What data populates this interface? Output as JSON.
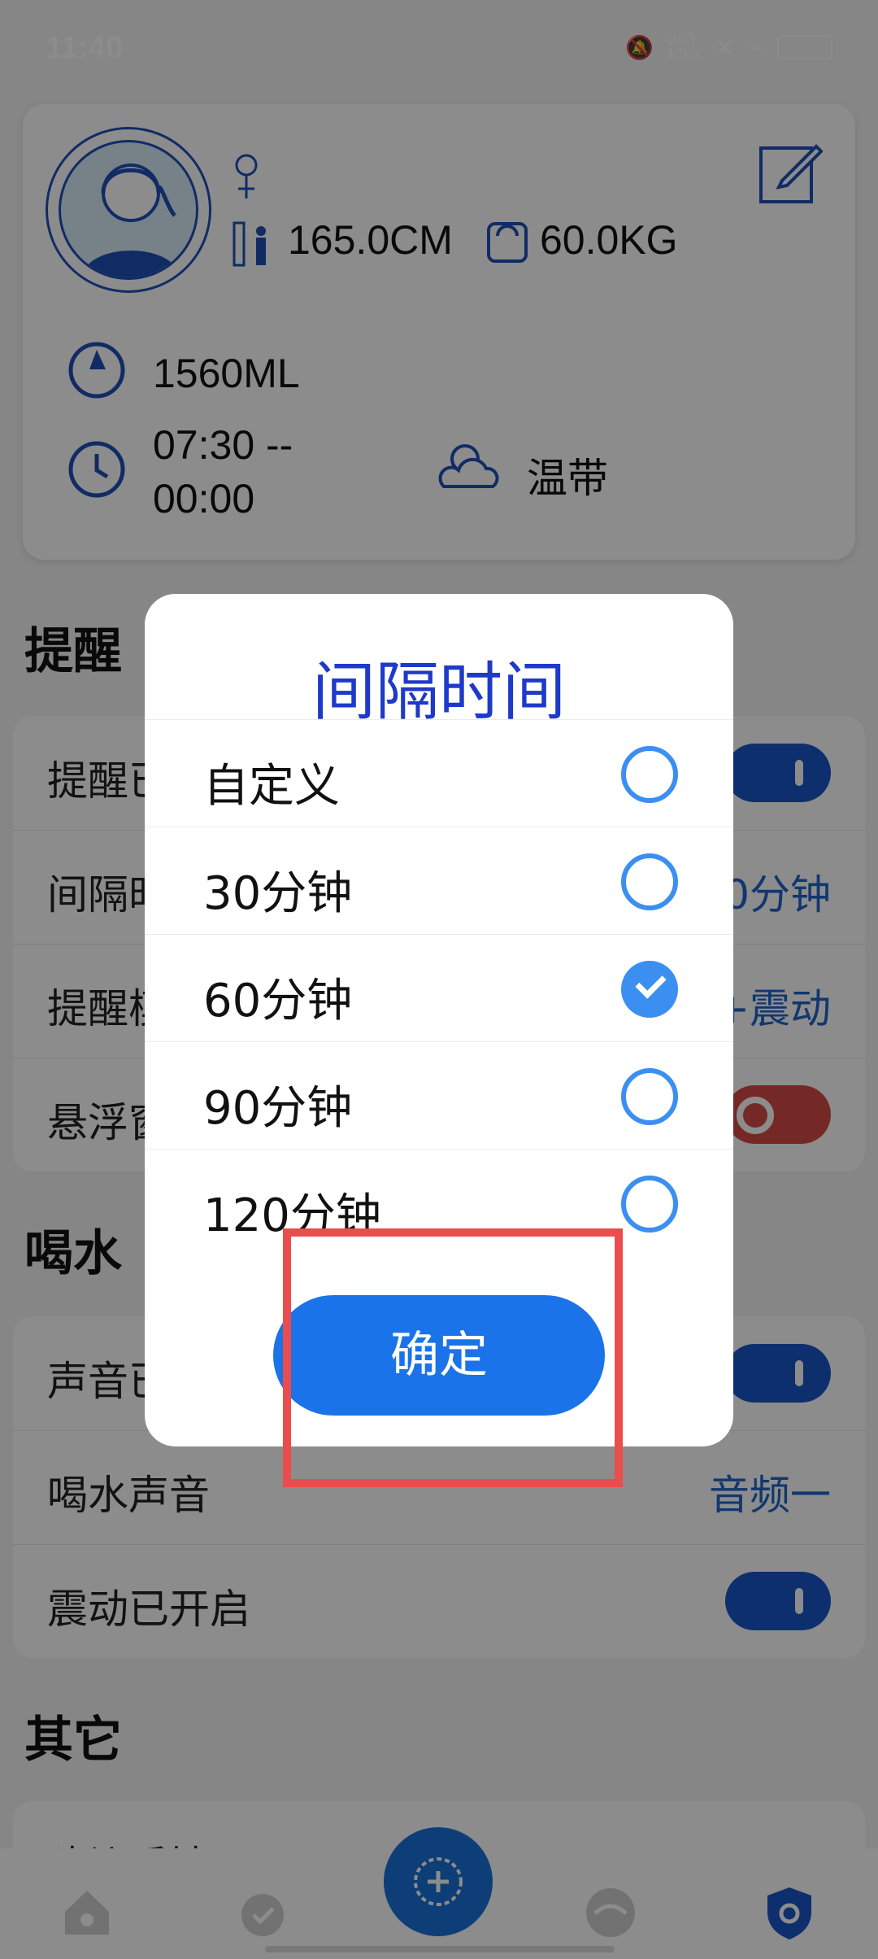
{
  "status": {
    "time": "11:40",
    "network_speed": "203\nKB/s"
  },
  "profile": {
    "height": "165.0CM",
    "weight": "60.0KG",
    "water": "1560ML",
    "time_range_line1": "07:30 --",
    "time_range_line2": "00:00",
    "climate": "温带"
  },
  "sections": {
    "reminder": "提醒",
    "drink": "喝水",
    "other": "其它"
  },
  "reminder_rows": [
    {
      "label": "提醒已开启",
      "value": ""
    },
    {
      "label": "间隔时间",
      "value": "60分钟"
    },
    {
      "label": "提醒模式",
      "value": "铃声+震动"
    },
    {
      "label": "悬浮窗",
      "value": ""
    }
  ],
  "drink_rows": [
    {
      "label": "声音已开启"
    },
    {
      "label": "喝水声音",
      "value": "音频一"
    },
    {
      "label": "震动已开启"
    }
  ],
  "other_rows": [
    {
      "label": "建议反馈"
    }
  ],
  "dialog": {
    "title": "间隔时间",
    "options": [
      {
        "label": "自定义",
        "checked": false
      },
      {
        "label": "30分钟",
        "checked": false
      },
      {
        "label": "60分钟",
        "checked": true
      },
      {
        "label": "90分钟",
        "checked": false
      },
      {
        "label": "120分钟",
        "checked": false
      }
    ],
    "confirm": "确定"
  },
  "colors": {
    "primary": "#1a73e8",
    "toggle_on": "#1a57c7",
    "toggle_off": "#d54c48",
    "highlight": "#eb4d4d"
  }
}
